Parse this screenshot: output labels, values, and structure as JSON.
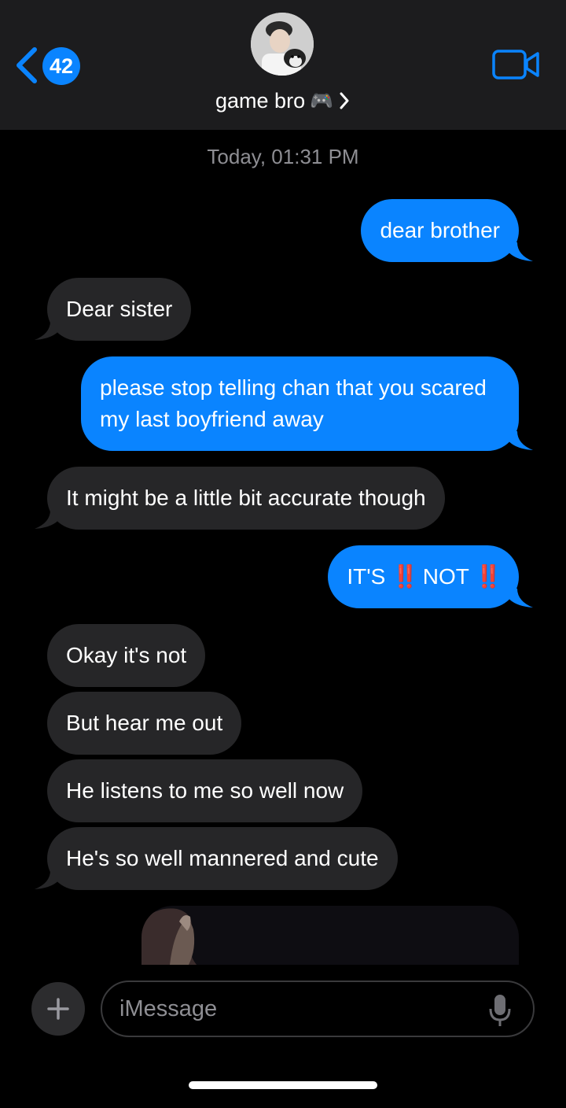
{
  "header": {
    "back_count": "42",
    "contact_name": "game bro",
    "contact_emoji": "🎮",
    "icons": {
      "back": "chevron-left-icon",
      "video": "video-camera-icon",
      "disclosure": "chevron-right-icon"
    }
  },
  "conversation": {
    "timestamp": "Today, 01:31 PM",
    "messages": [
      {
        "sender": "me",
        "text": "dear brother"
      },
      {
        "sender": "them",
        "text": "Dear sister"
      },
      {
        "sender": "me",
        "text": "please stop telling chan that you scared my last boyfriend away"
      },
      {
        "sender": "them",
        "text": "It might be a little bit accurate though"
      },
      {
        "sender": "me",
        "parts": [
          "IT'S",
          "‼️",
          "NOT",
          "‼️"
        ]
      },
      {
        "sender": "them",
        "text": "Okay it's not"
      },
      {
        "sender": "them",
        "text": "But hear me out"
      },
      {
        "sender": "them",
        "text": "He listens to me so well now"
      },
      {
        "sender": "them",
        "text": "He's so well mannered and cute"
      },
      {
        "sender": "me",
        "type": "photo"
      }
    ]
  },
  "composer": {
    "placeholder": "iMessage",
    "icons": {
      "plus": "plus-icon",
      "mic": "microphone-icon"
    }
  },
  "colors": {
    "sent_bubble": "#0a84ff",
    "received_bubble": "#262628",
    "header_bg": "#1c1c1e",
    "accent": "#0a84ff"
  }
}
